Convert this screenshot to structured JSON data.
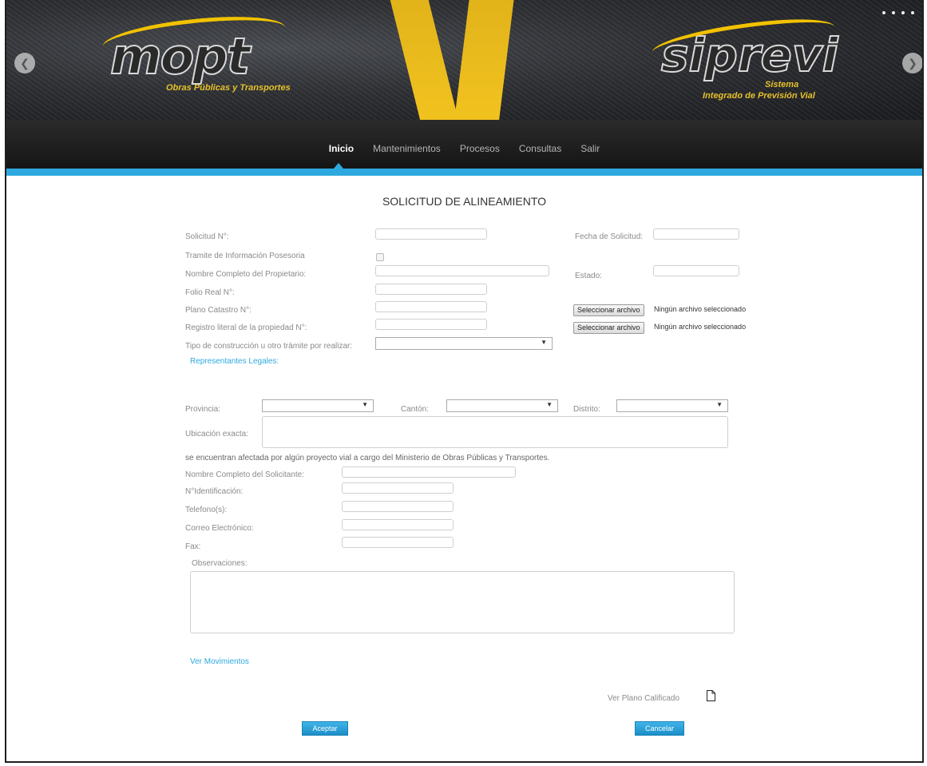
{
  "banner": {
    "left_logo": "mopt",
    "left_tagline": "Obras Públicas y Transportes",
    "right_logo": "siprevi",
    "right_tagline_1": "Sistema",
    "right_tagline_2": "Integrado de Previsión Vial",
    "prev_arrow": "❮",
    "next_arrow": "❯"
  },
  "nav": {
    "items": [
      "Inicio",
      "Mantenimientos",
      "Procesos",
      "Consultas",
      "Salir"
    ],
    "active": "Inicio"
  },
  "form": {
    "title": "SOLICITUD DE ALINEAMIENTO",
    "solicitud_label": "Solicitud N°:",
    "fecha_label": "Fecha de Solicitud:",
    "tramite_label": "Tramite de Información Posesoria",
    "propietario_label": "Nombre Completo del Propietario:",
    "estado_label": "Estado:",
    "folio_label": "Folio Real N°:",
    "plano_label": "Plano Catastro N°:",
    "registro_label": "Registro literal de la propiedad N°:",
    "tipo_label": "Tipo de construcción u otro trámite por realizar:",
    "file_button": "Seleccionar archivo",
    "file_status": "Ningún archivo seleccionado",
    "representantes_link": "Representantes Legales:",
    "provincia_label": "Provincia:",
    "canton_label": "Cantón:",
    "distrito_label": "Distrito:",
    "ubicacion_label": "Ubicación exacta:",
    "afectada_text": "se encuentran afectada por algún proyecto vial a cargo del Ministerio de Obras Públicas y Transportes.",
    "solicitante_label": "Nombre Completo del Solicitante:",
    "identificacion_label": "N°Identificación:",
    "telefono_label": "Telefono(s):",
    "correo_label": "Correo Electrónico:",
    "fax_label": "Fax:",
    "observaciones_label": "Observaciones:",
    "movimientos_link": "Ver Movimientos",
    "plano_calificado_label": "Ver Plano Calificado",
    "accept_button": "Aceptar",
    "cancel_button": "Cancelar"
  },
  "colors": {
    "accent": "#2ea9df",
    "nav_bg": "#1f1f1f",
    "stripe": "#f3c41f"
  }
}
